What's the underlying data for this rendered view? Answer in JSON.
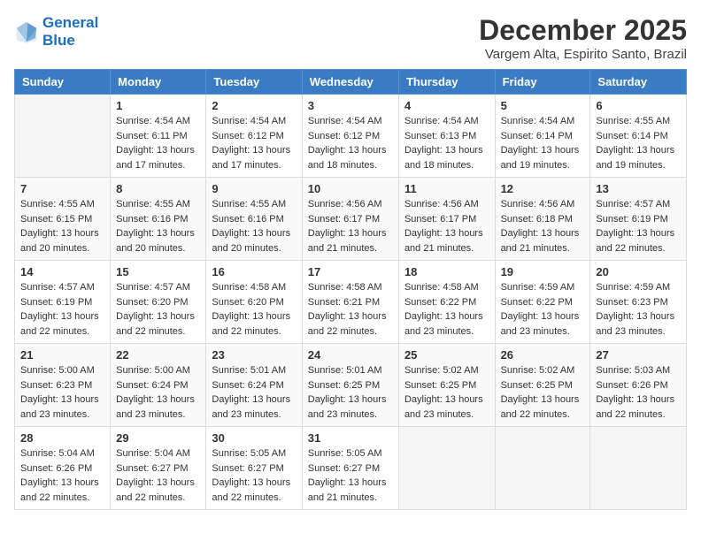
{
  "header": {
    "logo_line1": "General",
    "logo_line2": "Blue",
    "month": "December 2025",
    "location": "Vargem Alta, Espirito Santo, Brazil"
  },
  "weekdays": [
    "Sunday",
    "Monday",
    "Tuesday",
    "Wednesday",
    "Thursday",
    "Friday",
    "Saturday"
  ],
  "weeks": [
    [
      {
        "day": "",
        "content": ""
      },
      {
        "day": "1",
        "content": "Sunrise: 4:54 AM\nSunset: 6:11 PM\nDaylight: 13 hours\nand 17 minutes."
      },
      {
        "day": "2",
        "content": "Sunrise: 4:54 AM\nSunset: 6:12 PM\nDaylight: 13 hours\nand 17 minutes."
      },
      {
        "day": "3",
        "content": "Sunrise: 4:54 AM\nSunset: 6:12 PM\nDaylight: 13 hours\nand 18 minutes."
      },
      {
        "day": "4",
        "content": "Sunrise: 4:54 AM\nSunset: 6:13 PM\nDaylight: 13 hours\nand 18 minutes."
      },
      {
        "day": "5",
        "content": "Sunrise: 4:54 AM\nSunset: 6:14 PM\nDaylight: 13 hours\nand 19 minutes."
      },
      {
        "day": "6",
        "content": "Sunrise: 4:55 AM\nSunset: 6:14 PM\nDaylight: 13 hours\nand 19 minutes."
      }
    ],
    [
      {
        "day": "7",
        "content": "Sunrise: 4:55 AM\nSunset: 6:15 PM\nDaylight: 13 hours\nand 20 minutes."
      },
      {
        "day": "8",
        "content": "Sunrise: 4:55 AM\nSunset: 6:16 PM\nDaylight: 13 hours\nand 20 minutes."
      },
      {
        "day": "9",
        "content": "Sunrise: 4:55 AM\nSunset: 6:16 PM\nDaylight: 13 hours\nand 20 minutes."
      },
      {
        "day": "10",
        "content": "Sunrise: 4:56 AM\nSunset: 6:17 PM\nDaylight: 13 hours\nand 21 minutes."
      },
      {
        "day": "11",
        "content": "Sunrise: 4:56 AM\nSunset: 6:17 PM\nDaylight: 13 hours\nand 21 minutes."
      },
      {
        "day": "12",
        "content": "Sunrise: 4:56 AM\nSunset: 6:18 PM\nDaylight: 13 hours\nand 21 minutes."
      },
      {
        "day": "13",
        "content": "Sunrise: 4:57 AM\nSunset: 6:19 PM\nDaylight: 13 hours\nand 22 minutes."
      }
    ],
    [
      {
        "day": "14",
        "content": "Sunrise: 4:57 AM\nSunset: 6:19 PM\nDaylight: 13 hours\nand 22 minutes."
      },
      {
        "day": "15",
        "content": "Sunrise: 4:57 AM\nSunset: 6:20 PM\nDaylight: 13 hours\nand 22 minutes."
      },
      {
        "day": "16",
        "content": "Sunrise: 4:58 AM\nSunset: 6:20 PM\nDaylight: 13 hours\nand 22 minutes."
      },
      {
        "day": "17",
        "content": "Sunrise: 4:58 AM\nSunset: 6:21 PM\nDaylight: 13 hours\nand 22 minutes."
      },
      {
        "day": "18",
        "content": "Sunrise: 4:58 AM\nSunset: 6:22 PM\nDaylight: 13 hours\nand 23 minutes."
      },
      {
        "day": "19",
        "content": "Sunrise: 4:59 AM\nSunset: 6:22 PM\nDaylight: 13 hours\nand 23 minutes."
      },
      {
        "day": "20",
        "content": "Sunrise: 4:59 AM\nSunset: 6:23 PM\nDaylight: 13 hours\nand 23 minutes."
      }
    ],
    [
      {
        "day": "21",
        "content": "Sunrise: 5:00 AM\nSunset: 6:23 PM\nDaylight: 13 hours\nand 23 minutes."
      },
      {
        "day": "22",
        "content": "Sunrise: 5:00 AM\nSunset: 6:24 PM\nDaylight: 13 hours\nand 23 minutes."
      },
      {
        "day": "23",
        "content": "Sunrise: 5:01 AM\nSunset: 6:24 PM\nDaylight: 13 hours\nand 23 minutes."
      },
      {
        "day": "24",
        "content": "Sunrise: 5:01 AM\nSunset: 6:25 PM\nDaylight: 13 hours\nand 23 minutes."
      },
      {
        "day": "25",
        "content": "Sunrise: 5:02 AM\nSunset: 6:25 PM\nDaylight: 13 hours\nand 23 minutes."
      },
      {
        "day": "26",
        "content": "Sunrise: 5:02 AM\nSunset: 6:25 PM\nDaylight: 13 hours\nand 22 minutes."
      },
      {
        "day": "27",
        "content": "Sunrise: 5:03 AM\nSunset: 6:26 PM\nDaylight: 13 hours\nand 22 minutes."
      }
    ],
    [
      {
        "day": "28",
        "content": "Sunrise: 5:04 AM\nSunset: 6:26 PM\nDaylight: 13 hours\nand 22 minutes."
      },
      {
        "day": "29",
        "content": "Sunrise: 5:04 AM\nSunset: 6:27 PM\nDaylight: 13 hours\nand 22 minutes."
      },
      {
        "day": "30",
        "content": "Sunrise: 5:05 AM\nSunset: 6:27 PM\nDaylight: 13 hours\nand 22 minutes."
      },
      {
        "day": "31",
        "content": "Sunrise: 5:05 AM\nSunset: 6:27 PM\nDaylight: 13 hours\nand 21 minutes."
      },
      {
        "day": "",
        "content": ""
      },
      {
        "day": "",
        "content": ""
      },
      {
        "day": "",
        "content": ""
      }
    ]
  ]
}
